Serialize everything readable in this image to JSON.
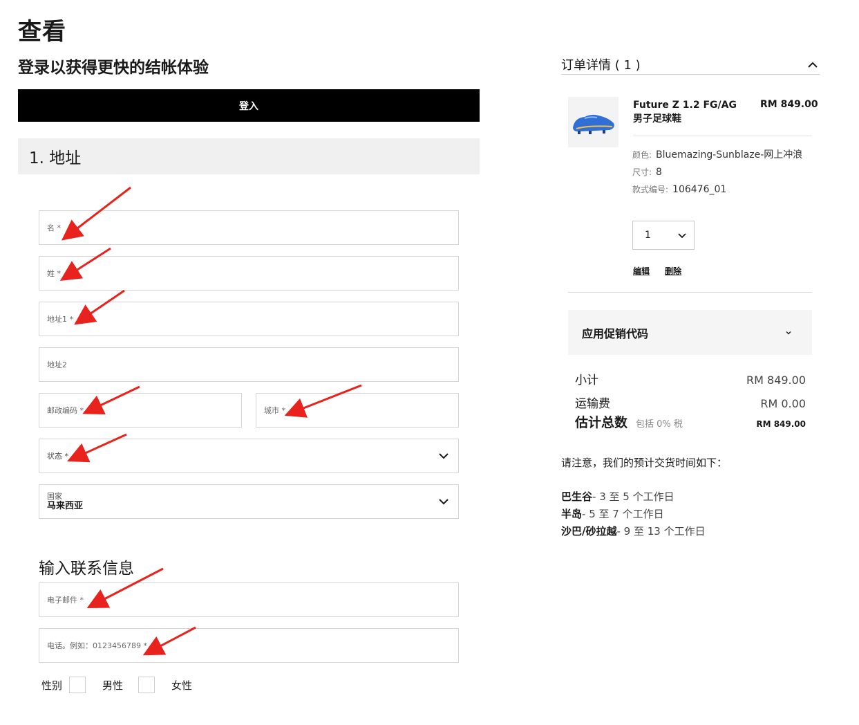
{
  "page": {
    "title": "查看",
    "login_heading": "登录以获得更快的结帐体验",
    "login_button": "登入"
  },
  "address": {
    "section_title": "1. 地址",
    "first_name_label": "名 *",
    "last_name_label": "姓 *",
    "address1_label": "地址1 *",
    "address2_label": "地址2",
    "postcode_label": "邮政编码 *",
    "city_label": "城市 *",
    "state_label": "状态 *",
    "country_label": "国家",
    "country_value": "马来西亚"
  },
  "contact": {
    "heading": "输入联系信息",
    "email_label": "电子邮件 *",
    "phone_label": "电话。例如：0123456789 *",
    "gender_label": "性别",
    "male_label": "男性",
    "female_label": "女性"
  },
  "order": {
    "header": "订单详情 ( 1 )",
    "product": {
      "name_line1": "Future Z 1.2 FG/AG",
      "name_line2": "男子足球鞋",
      "price": "RM 849.00",
      "color_key": "颜色:",
      "color_value": "Bluemazing-Sunblaze-网上冲浪",
      "size_key": "尺寸:",
      "size_value": "8",
      "style_key": "款式编号:",
      "style_value": "106476_01",
      "quantity": "1",
      "edit_label": "编辑",
      "delete_label": "删除"
    },
    "promo_label": "应用促销代码",
    "subtotal_label": "小计",
    "subtotal_value": "RM 849.00",
    "shipping_label": "运输费",
    "shipping_value": "RM 0.00",
    "total_label": "估计总数",
    "total_tax_note": "包括 0% 税",
    "total_value": "RM 849.00"
  },
  "delivery": {
    "note": "请注意，我们的预计交货时间如下：",
    "items": [
      {
        "region": "巴生谷",
        "time": "- 3 至 5 个工作日"
      },
      {
        "region": "半岛",
        "time": "- 5 至 7 个工作日"
      },
      {
        "region": "沙巴/砂拉越",
        "time": "- 9 至 13 个工作日"
      }
    ]
  },
  "colors": {
    "accent_arrow": "#e8231d",
    "button_bg": "#000000",
    "product_blue": "#2f6fd6"
  }
}
